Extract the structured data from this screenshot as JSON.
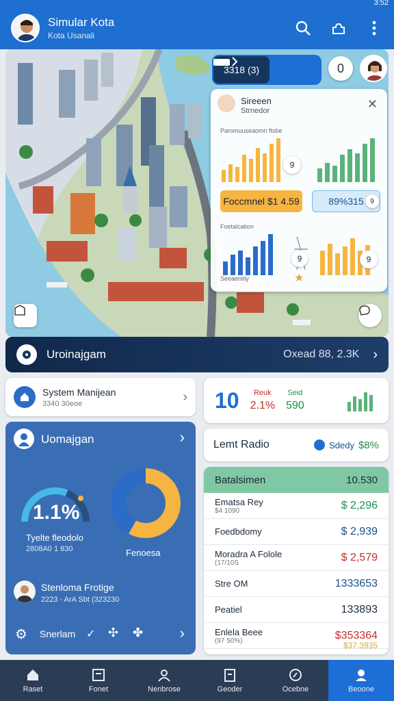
{
  "status": {
    "time": "3:52"
  },
  "header": {
    "title": "Simular Kota",
    "subtitle": "Kota Usanali"
  },
  "map": {
    "pill_dark": "3318 (3)",
    "badge_circle": "0",
    "panel": {
      "title": "Sireeen",
      "subtitle": "Strnedor",
      "label_top": "Paromuuseaomn ftsbe",
      "chip_left_value": "Foccmnel $1 4.59",
      "chip_right_value": "89%315",
      "label_mid": "Foetalcation",
      "label_bottom": "Seeaenitiy",
      "circle_1": "9",
      "circle_2": "9",
      "circle_3": "9",
      "circle_4": "9"
    }
  },
  "management_bar": {
    "title": "Uroinajgam",
    "value": "Oxead 88, 2.3K"
  },
  "system_card": {
    "title": "System Manijean",
    "subtitle": "3340 30eoe"
  },
  "stats_card": {
    "big_value": "10",
    "col1_label": "Reuk",
    "col1_value": "2.1%",
    "col2_label": "Seid",
    "col2_value": "590"
  },
  "limit_card": {
    "label": "Lemt Radio",
    "tag_label": "Sdedy",
    "tag_value": "$8%"
  },
  "blue_panel": {
    "title": "Uomajgan",
    "gauge_value": "1.1%",
    "gauge_label": "Tyelte fleodolo",
    "gauge_sub": "2808A0 1 830",
    "gauge_fill": 0.62,
    "donut_label": "Fenoesa",
    "donut_share": 0.58,
    "person_title": "Stenloma Frotige",
    "person_sub": "2223 - ArA Sbt (323230",
    "footer_label": "Snerlam"
  },
  "table": {
    "header_label": "Batalsimen",
    "header_value": "10.530",
    "rows": [
      {
        "name": "Ematsa Rey",
        "sub": "$4 1090",
        "value": "$ 2,296",
        "color": "#1e8f4a"
      },
      {
        "name": "Foedbdomy",
        "sub": "",
        "value": "$ 2,939",
        "color": "#1a4f8a"
      },
      {
        "name": "Moradra A Folole",
        "sub": "(17/10S",
        "value": "$ 2,579",
        "color": "#c0302e"
      },
      {
        "name": "Stre OM",
        "sub": "",
        "value": "1333653",
        "color": "#1a4f8a"
      },
      {
        "name": "Peatiel",
        "sub": "",
        "value": "133893",
        "color": "#1a2a40"
      },
      {
        "name": "Enlela Beee",
        "sub": "(97 50%)",
        "value": "$353364",
        "color": "#c0302e"
      }
    ],
    "last_row_extra": "$37.3935"
  },
  "colors": {
    "primary": "#1e6fd0",
    "nav": "#2b3d55",
    "green": "#7fc8a3",
    "orange": "#f6b540"
  },
  "nav": {
    "items": [
      {
        "label": "Raset",
        "icon": "home-icon"
      },
      {
        "label": "Fonet",
        "icon": "document-icon"
      },
      {
        "label": "Nenbrose",
        "icon": "person-icon"
      },
      {
        "label": "Geoder",
        "icon": "clipboard-icon"
      },
      {
        "label": "Ocebne",
        "icon": "compass-icon"
      },
      {
        "label": "Beoone",
        "icon": "profile-icon"
      }
    ]
  }
}
